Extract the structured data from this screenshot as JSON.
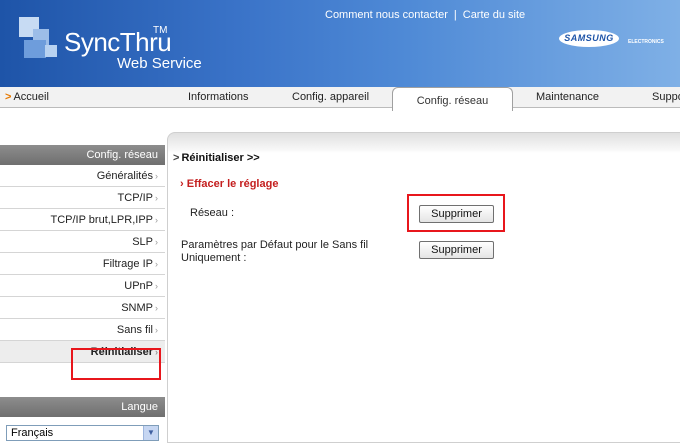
{
  "header": {
    "logo_title": "SyncThru",
    "logo_tm": "TM",
    "logo_sub": "Web Service",
    "link_contact": "Comment nous contacter",
    "link_sep": "|",
    "link_sitemap": "Carte du site",
    "brand": "SAMSUNG",
    "brand_sub": "ELECTRONICS"
  },
  "nav": {
    "home": "Accueil",
    "tabs": [
      "Informations",
      "Config. appareil",
      "Config. réseau",
      "Maintenance",
      "Support"
    ],
    "active": "Config. réseau"
  },
  "sidebar": {
    "header": "Config. réseau",
    "items": [
      "Généralités",
      "TCP/IP",
      "TCP/IP brut,LPR,IPP",
      "SLP",
      "Filtrage IP",
      "UPnP",
      "SNMP",
      "Sans fil",
      "Réinitialiser"
    ],
    "active": "Réinitialiser"
  },
  "language": {
    "header": "Langue",
    "selected": "Français"
  },
  "main": {
    "breadcrumb": "Réinitialiser >>",
    "section_title": "Effacer le réglage",
    "rows": [
      {
        "label": "Réseau :",
        "button": "Supprimer"
      },
      {
        "label": "Paramètres par Défaut pour le Sans fil Uniquement :",
        "button": "Supprimer"
      }
    ]
  },
  "colors": {
    "header_blue": "#1e54a8",
    "highlight_red": "#e8161c",
    "section_red": "#c41e1e",
    "nav_arrow": "#e67800"
  }
}
